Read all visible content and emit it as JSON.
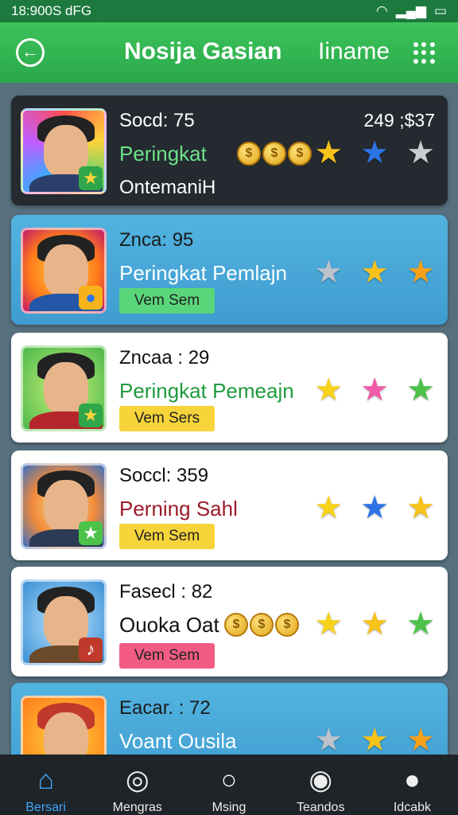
{
  "status_bar": {
    "time": "18:900S dFG"
  },
  "app_bar": {
    "title": "Nosija Gasian",
    "right_title": "Iiname"
  },
  "cards": [
    {
      "name": "Socd: 75",
      "subtitle": "Peringkat",
      "third_line": "OntemaniH",
      "coins_total": "249 ;$37",
      "coins": [
        "$",
        "$",
        "$"
      ],
      "stars": [
        {
          "color": "#f7c21a"
        },
        {
          "color": "#2d73e6"
        },
        {
          "color": "#c9ced4"
        }
      ]
    },
    {
      "name": "Znca: 95",
      "subtitle": "Peringkat Pemlajn",
      "button": "Vem Sem",
      "button_color": "#59d67a",
      "stars": [
        {
          "color": "#bcc3cc"
        },
        {
          "color": "#f7c21a"
        },
        {
          "color": "#f7a11a"
        }
      ]
    },
    {
      "name": "Zncaa : 29",
      "subtitle": "Peringkat Pemeajn",
      "subtitle_color": "#1f9a3e",
      "button": "Vem Sers",
      "button_color": "#f6d43a",
      "stars": [
        {
          "color": "#f7d21a"
        },
        {
          "color": "#f05aa8"
        },
        {
          "color": "#4cc24a"
        }
      ]
    },
    {
      "name": "Soccl: 359",
      "subtitle": "Perning Sahl",
      "subtitle_color": "#9b1b2a",
      "button": "Vem Sem",
      "button_color": "#f6d43a",
      "stars": [
        {
          "color": "#f7d21a"
        },
        {
          "color": "#2d73e6"
        },
        {
          "color": "#f7c21a"
        }
      ]
    },
    {
      "name": "Fasecl : 82",
      "subtitle": "Ouoka Oat",
      "subtitle_color": "#111111",
      "button": "Vem Sem",
      "button_color": "#f25c84",
      "coins": [
        "$",
        "$",
        "$"
      ],
      "stars": [
        {
          "color": "#f7d21a"
        },
        {
          "color": "#f7c21a"
        },
        {
          "color": "#4cc24a"
        }
      ]
    },
    {
      "name": "Eacar. : 72",
      "subtitle": "Voant Ousila",
      "stars": [
        {
          "color": "#bcc3cc"
        },
        {
          "color": "#f7c21a"
        },
        {
          "color": "#f7a11a"
        }
      ]
    }
  ],
  "nav": [
    {
      "label": "Bersari",
      "icon": "home-icon"
    },
    {
      "label": "Mengras",
      "icon": "compass-icon"
    },
    {
      "label": "Msing",
      "icon": "search-icon"
    },
    {
      "label": "Teandos",
      "icon": "trophy-icon"
    },
    {
      "label": "Idcabk",
      "icon": "profile-icon"
    }
  ]
}
